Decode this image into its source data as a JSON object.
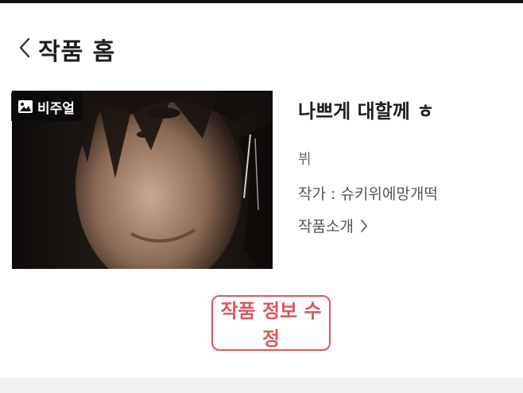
{
  "header": {
    "title": "작품 홈",
    "back_icon": "chevron-left-icon"
  },
  "work": {
    "badge_label": "비주얼",
    "badge_icon": "image-icon",
    "title": "나쁘게 대할께 ㅎ",
    "genre": "뷔",
    "author_label": "작가 ",
    "author_separator": ": ",
    "author_name": "슈키위에망개떡",
    "intro_label": "작품소개",
    "intro_icon": "chevron-right-icon"
  },
  "actions": {
    "edit_label": "작품 정보 수정"
  },
  "colors": {
    "accent": "#e0545c",
    "text_primary": "#1e1e1e",
    "text_secondary": "#555555",
    "bottom_band": "#f1f1f3"
  }
}
